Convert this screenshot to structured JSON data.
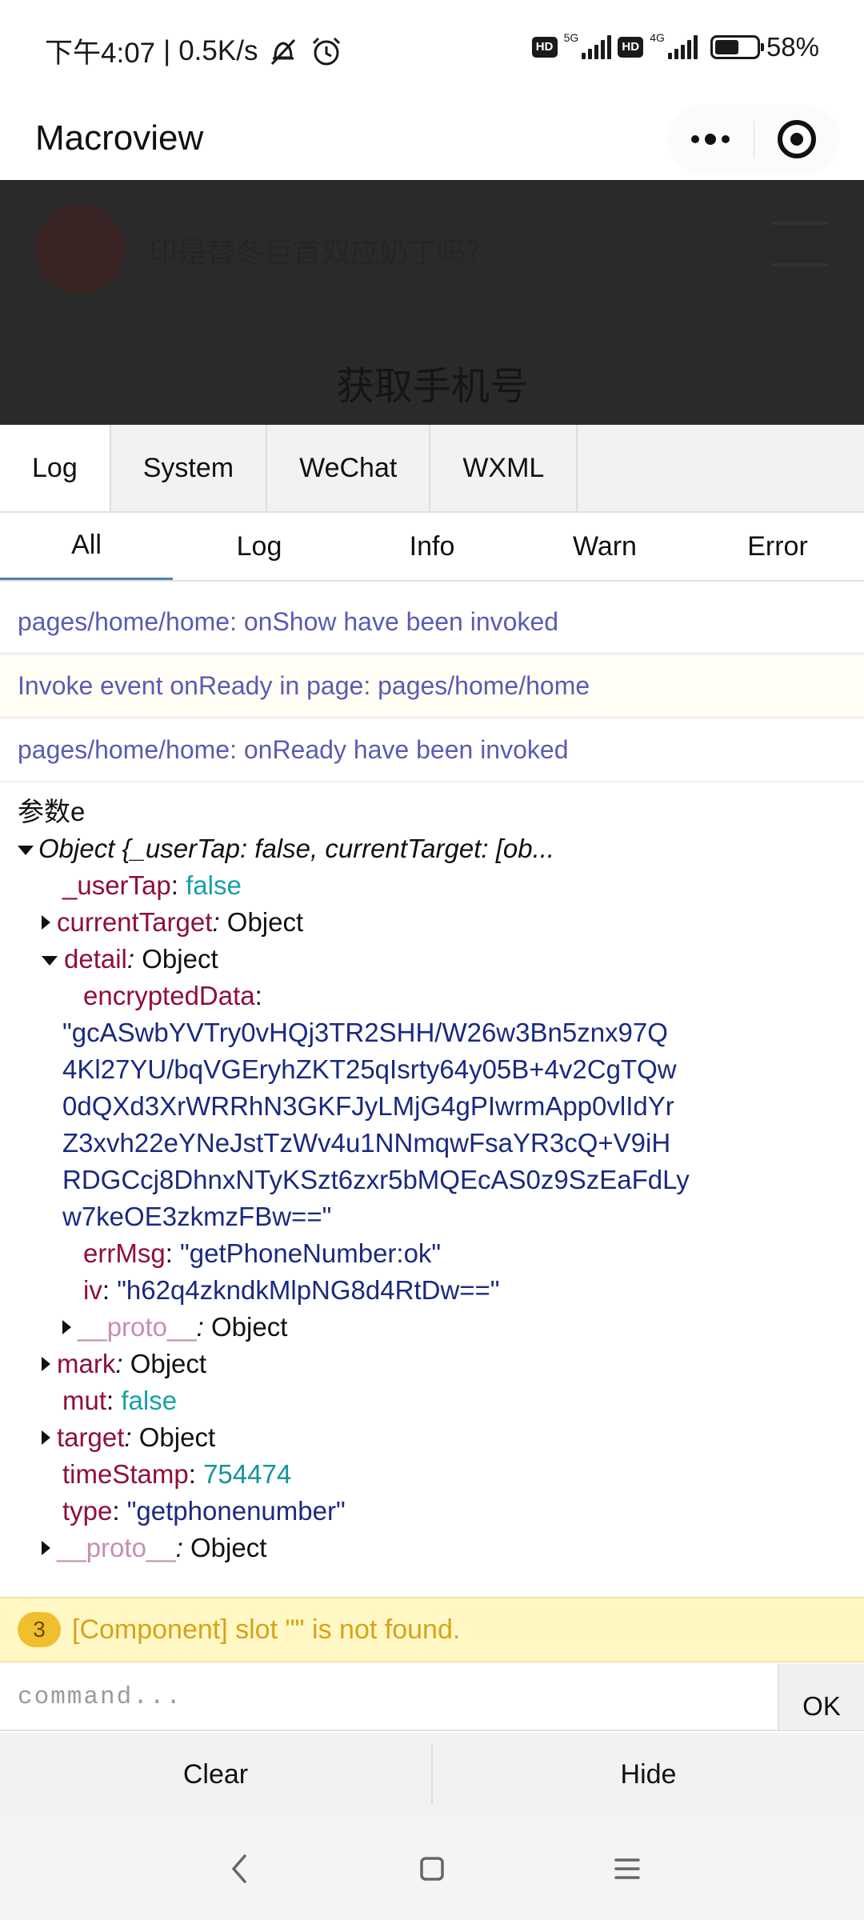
{
  "status_bar": {
    "time": "下午4:07",
    "separator": "|",
    "speed": "0.5K/s",
    "battery_percent": "58%",
    "battery_level": 0.58,
    "hd_label": "HD",
    "sim1_network": "5G",
    "sim2_network": "4G"
  },
  "nav": {
    "title": "Macroview"
  },
  "page_behind": {
    "text": "印是替冬巨首双应奶丁吗？",
    "get_phone_button": "获取手机号"
  },
  "tabs": [
    {
      "label": "Log",
      "active": true
    },
    {
      "label": "System",
      "active": false
    },
    {
      "label": "WeChat",
      "active": false
    },
    {
      "label": "WXML",
      "active": false
    }
  ],
  "filters": [
    {
      "label": "All",
      "active": true
    },
    {
      "label": "Log",
      "active": false
    },
    {
      "label": "Info",
      "active": false
    },
    {
      "label": "Warn",
      "active": false
    },
    {
      "label": "Error",
      "active": false
    }
  ],
  "log_lines": [
    "pages/home/home: onShow have been invoked",
    "Invoke event onReady in page: pages/home/home",
    "pages/home/home: onReady have been invoked"
  ],
  "object_log": {
    "label": "参数e",
    "summary": "Object {_userTap: false, currentTarget: [ob...",
    "userTap_key": "_userTap",
    "userTap_val": "false",
    "currentTarget_key": "currentTarget",
    "object_word": "Object",
    "detail_key": "detail",
    "encryptedData_key": "encryptedData",
    "encryptedData_val": "\"gcASwbYVTry0vHQj3TR2SHH/W26w3Bn5znx97Q\n4Kl27YU/bqVGEryhZKT25qIsrty64y05B+4v2CgTQw\n0dQXd3XrWRRhN3GKFJyLMjG4gPIwrmApp0vlIdYr\nZ3xvh22eYNeJstTzWv4u1NNmqwFsaYR3cQ+V9iH\nRDGCcj8DhnxNTyKSzt6zxr5bMQEcAS0z9SzEaFdLy\nw7keOE3zkmzFBw==\"",
    "errMsg_key": "errMsg",
    "errMsg_val": "\"getPhoneNumber:ok\"",
    "iv_key": "iv",
    "iv_val": "\"h62q4zkndkMlpNG8d4RtDw==\"",
    "proto_key": "__proto__",
    "mark_key": "mark",
    "mut_key": "mut",
    "mut_val": "false",
    "target_key": "target",
    "timeStamp_key": "timeStamp",
    "timeStamp_val": "754474",
    "type_key": "type",
    "type_val": "\"getphonenumber\""
  },
  "warning": {
    "count": "3",
    "message": "[Component] slot \"\" is not found."
  },
  "command": {
    "placeholder": "command...",
    "ok_label": "OK"
  },
  "actions": {
    "clear": "Clear",
    "hide": "Hide"
  }
}
